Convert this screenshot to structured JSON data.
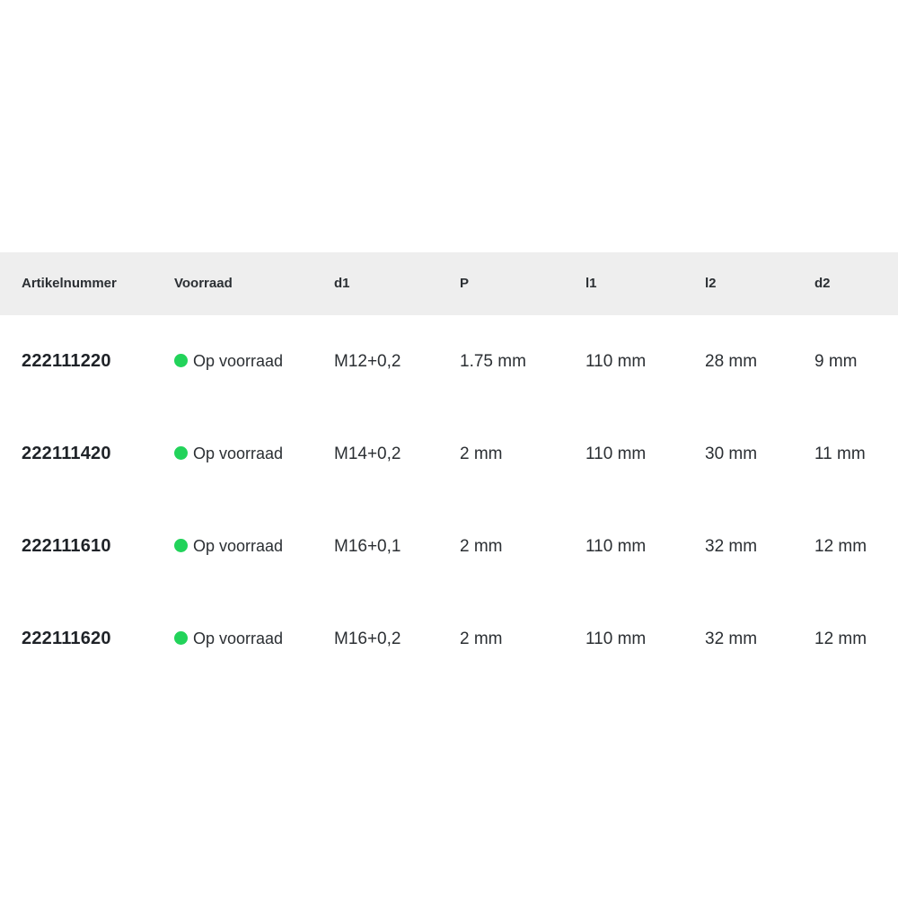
{
  "table": {
    "headers": [
      "Artikelnummer",
      "Voorraad",
      "d1",
      "P",
      "l1",
      "l2",
      "d2"
    ],
    "rows": [
      {
        "artikelnummer": "222111220",
        "voorraad": "Op voorraad",
        "d1": "M12+0,2",
        "p": "1.75 mm",
        "l1": "110 mm",
        "l2": "28 mm",
        "d2": "9 mm"
      },
      {
        "artikelnummer": "222111420",
        "voorraad": "Op voorraad",
        "d1": "M14+0,2",
        "p": "2 mm",
        "l1": "110 mm",
        "l2": "30 mm",
        "d2": "11 mm"
      },
      {
        "artikelnummer": "222111610",
        "voorraad": "Op voorraad",
        "d1": "M16+0,1",
        "p": "2 mm",
        "l1": "110 mm",
        "l2": "32 mm",
        "d2": "12 mm"
      },
      {
        "artikelnummer": "222111620",
        "voorraad": "Op voorraad",
        "d1": "M16+0,2",
        "p": "2 mm",
        "l1": "110 mm",
        "l2": "32 mm",
        "d2": "12 mm"
      }
    ]
  },
  "colors": {
    "header_bg": "#eeeeee",
    "in_stock": "#22d35a",
    "text": "#1f2328"
  },
  "icons": {
    "stock_status": "in-stock-dot-icon"
  }
}
